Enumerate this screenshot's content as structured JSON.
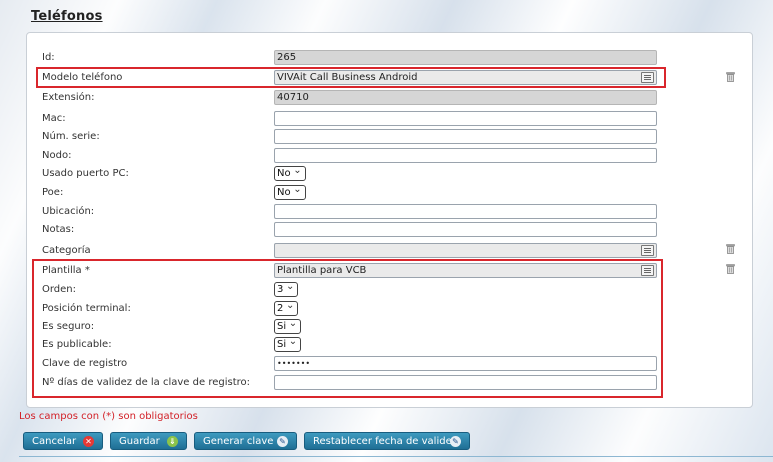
{
  "title": "Teléfonos",
  "fields": {
    "id": {
      "label": "Id:",
      "value": "265"
    },
    "modelo": {
      "label": "Modelo teléfono",
      "value": "VIVAit Call Business Android"
    },
    "extension": {
      "label": "Extensión:",
      "value": "40710"
    },
    "mac": {
      "label": "Mac:",
      "value": ""
    },
    "num_serie": {
      "label": "Núm. serie:",
      "value": ""
    },
    "nodo": {
      "label": "Nodo:",
      "value": ""
    },
    "usado_puerto": {
      "label": "Usado puerto PC:",
      "value": "No"
    },
    "poe": {
      "label": "Poe:",
      "value": "No"
    },
    "ubicacion": {
      "label": "Ubicación:",
      "value": ""
    },
    "notas": {
      "label": "Notas:",
      "value": ""
    },
    "categoria": {
      "label": "Categoría",
      "value": ""
    },
    "plantilla": {
      "label": "Plantilla *",
      "value": "Plantilla para VCB"
    },
    "orden": {
      "label": "Orden:",
      "value": "3"
    },
    "posicion": {
      "label": "Posición terminal:",
      "value": "2"
    },
    "es_seguro": {
      "label": "Es seguro:",
      "value": "Si"
    },
    "es_publicable": {
      "label": "Es publicable:",
      "value": "Si"
    },
    "clave": {
      "label": "Clave de registro",
      "value": "•••••••"
    },
    "dias_validez": {
      "label": "Nº días de validez de la clave de registro:",
      "value": ""
    }
  },
  "required_note": "Los campos con (*) son obligatorios",
  "buttons": {
    "cancelar": "Cancelar",
    "guardar": "Guardar",
    "generar": "Generar clave",
    "restablecer": "Restablecer fecha de validez"
  },
  "colors": {
    "accent": "#2a84ad",
    "highlight": "#d9262c",
    "required": "#d21f26"
  }
}
